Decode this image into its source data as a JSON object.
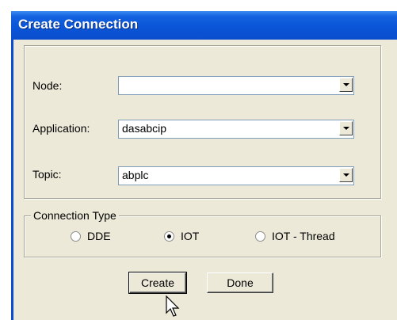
{
  "window": {
    "title": "Create Connection"
  },
  "form": {
    "node": {
      "label": "Node:",
      "value": ""
    },
    "application": {
      "label": "Application:",
      "value": "dasabcip"
    },
    "topic": {
      "label": "Topic:",
      "value": "abplc"
    }
  },
  "connection_type": {
    "legend": "Connection Type",
    "options": [
      {
        "label": "DDE",
        "selected": false
      },
      {
        "label": "IOT",
        "selected": true
      },
      {
        "label": "IOT - Thread",
        "selected": false
      }
    ]
  },
  "buttons": {
    "create": "Create",
    "done": "Done"
  },
  "icons": {
    "dropdown": "chevron-down-icon",
    "cursor": "mouse-pointer-icon"
  }
}
